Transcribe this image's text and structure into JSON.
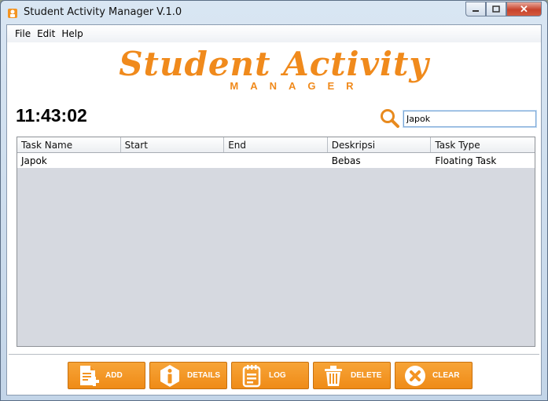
{
  "window": {
    "title": "Student Activity Manager V.1.0",
    "close_symbol": "✕"
  },
  "menu": [
    "File",
    "Edit",
    "Help"
  ],
  "logo": {
    "main": "Student Activity",
    "sub": "MANAGER",
    "color": "#f08a1c"
  },
  "clock": "11:43:02",
  "search": {
    "value": "Japok",
    "icon": "search-icon"
  },
  "table": {
    "columns": [
      "Task Name",
      "Start",
      "End",
      "Deskripsi",
      "Task Type"
    ],
    "rows": [
      [
        "Japok",
        "",
        "",
        "Bebas",
        "Floating Task"
      ]
    ]
  },
  "actions": {
    "add": "ADD",
    "details": "DETAILS",
    "log": "LOG",
    "delete": "DELETE",
    "clear": "CLEAR"
  },
  "accent": "#f39422"
}
